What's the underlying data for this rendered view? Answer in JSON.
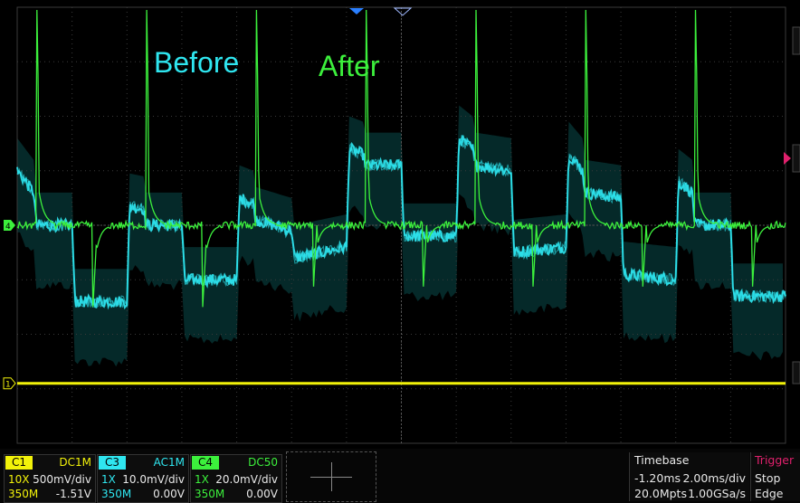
{
  "colors": {
    "c1": "#f2f20a",
    "c3": "#2fe6f0",
    "c3_shadow": "#0a5a5c",
    "c4": "#3cf03c",
    "trigger": "#e0206c",
    "panel_bg": "#0b0b0b",
    "grid": "#3a3a3a"
  },
  "annotations": {
    "before": "Before",
    "after": "After"
  },
  "markers": {
    "c4": "4",
    "c1": "1"
  },
  "channels": [
    {
      "tag": "C1",
      "coupling": "DC1M",
      "probe": "10X",
      "scale": "500mV/div",
      "bw": "350M",
      "offset": "-1.51V"
    },
    {
      "tag": "C3",
      "coupling": "AC1M",
      "probe": "1X",
      "scale": "10.0mV/div",
      "bw": "350M",
      "offset": "0.00V"
    },
    {
      "tag": "C4",
      "coupling": "DC50",
      "probe": "1X",
      "scale": "20.0mV/div",
      "bw": "350M",
      "offset": "0.00V"
    }
  ],
  "timebase": {
    "label": "Timebase",
    "position": "-1.20ms",
    "scale": "2.00ms/div",
    "memory": "20.0Mpts",
    "rate": "1.00GSa/s"
  },
  "trigger": {
    "label": "Trigger",
    "state": "Stop",
    "type": "Edge"
  },
  "chart_data": {
    "type": "line",
    "title": "",
    "xlabel": "",
    "ylabel": "",
    "grid": true,
    "xlim_div": [
      0,
      14
    ],
    "ylim_div": [
      0,
      8
    ],
    "series": [
      {
        "name": "C3",
        "x_div": [
          0,
          0.3,
          0.35,
          1.0,
          1.05,
          2.0,
          2.05,
          2.3,
          2.35,
          3.0,
          3.05,
          4.0,
          4.05,
          4.3,
          4.35,
          5.0,
          5.05,
          6.0,
          6.05,
          6.3,
          6.35,
          7.0,
          7.05,
          8.0,
          8.05,
          8.3,
          8.35,
          9.0,
          9.05,
          10.0,
          10.05,
          10.3,
          10.35,
          11.0,
          11.05,
          12.0,
          12.05,
          12.3,
          12.35,
          13.0,
          13.05,
          14.0
        ],
        "level_div": [
          5.0,
          4.6,
          4.0,
          4.0,
          2.6,
          2.6,
          4.35,
          4.3,
          4.0,
          4.0,
          3.0,
          3.0,
          4.5,
          4.4,
          4.1,
          3.9,
          3.4,
          3.6,
          5.4,
          5.3,
          5.1,
          5.1,
          3.8,
          3.8,
          5.6,
          5.4,
          5.1,
          5.0,
          3.5,
          3.6,
          5.3,
          5.0,
          4.6,
          4.5,
          3.1,
          3.0,
          4.8,
          4.6,
          4.0,
          4.0,
          2.7,
          2.7
        ]
      },
      {
        "name": "C4",
        "baseline_div": 4.0,
        "edges_x_div": [
          0.0,
          2.0,
          4.0,
          6.0,
          8.0,
          10.0,
          12.0
        ],
        "spike_peak_div": [
          2.95,
          2.95,
          2.95,
          2.95,
          2.95,
          2.95,
          2.95
        ]
      },
      {
        "name": "C1",
        "level_div": 1.1
      }
    ]
  }
}
